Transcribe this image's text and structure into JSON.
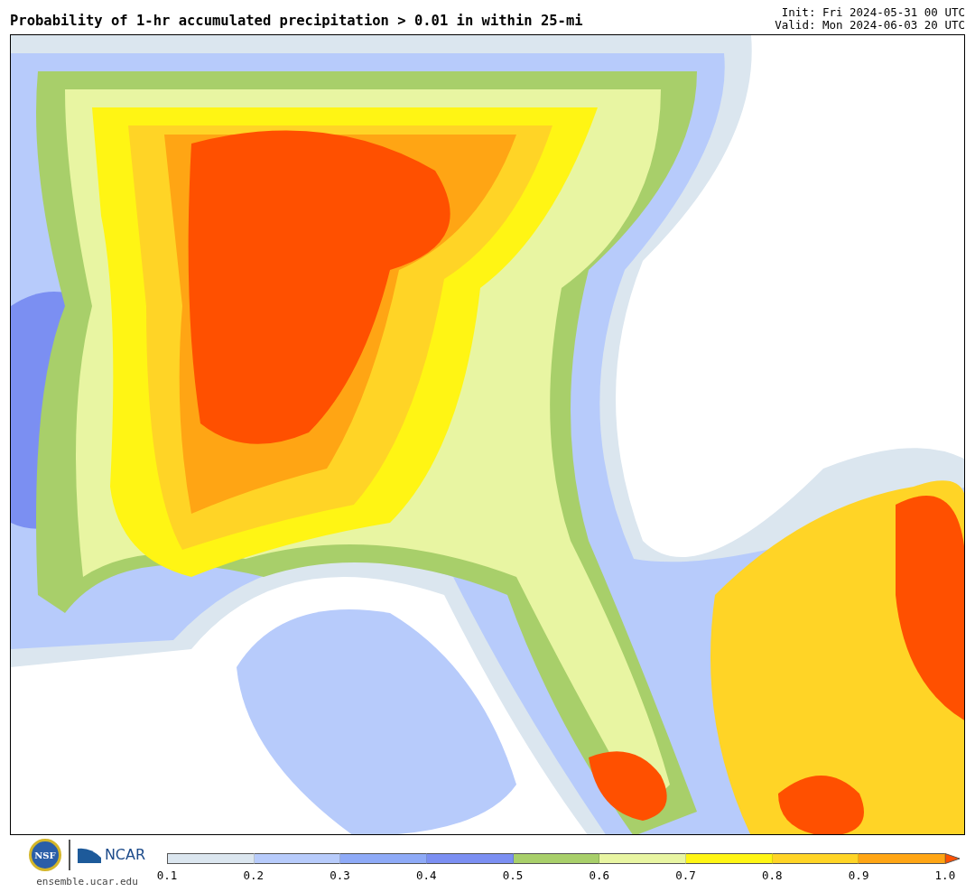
{
  "header": {
    "title": "Probability of 1-hr accumulated precipitation > 0.01 in within 25-mi",
    "init": "Init: Fri 2024-05-31 00 UTC",
    "valid": "Valid: Mon 2024-06-03 20 UTC"
  },
  "footer": {
    "nsf_logo": "NSF",
    "ncar_logo": "NCAR",
    "site": "ensemble.ucar.edu"
  },
  "colorbar": {
    "segments": [
      {
        "color": "#dbe6ef"
      },
      {
        "color": "#b7cbfb"
      },
      {
        "color": "#8eaaf7"
      },
      {
        "color": "#7b8ff2"
      },
      {
        "color": "#a8cf6a"
      },
      {
        "color": "#e8f5a2"
      },
      {
        "color": "#fff514"
      },
      {
        "color": "#ffd426"
      },
      {
        "color": "#ffa514"
      }
    ],
    "extend": {
      "color": "#ff5000"
    },
    "ticks": [
      "0.1",
      "0.2",
      "0.3",
      "0.4",
      "0.5",
      "0.6",
      "0.7",
      "0.8",
      "0.9",
      "1.0"
    ]
  }
}
